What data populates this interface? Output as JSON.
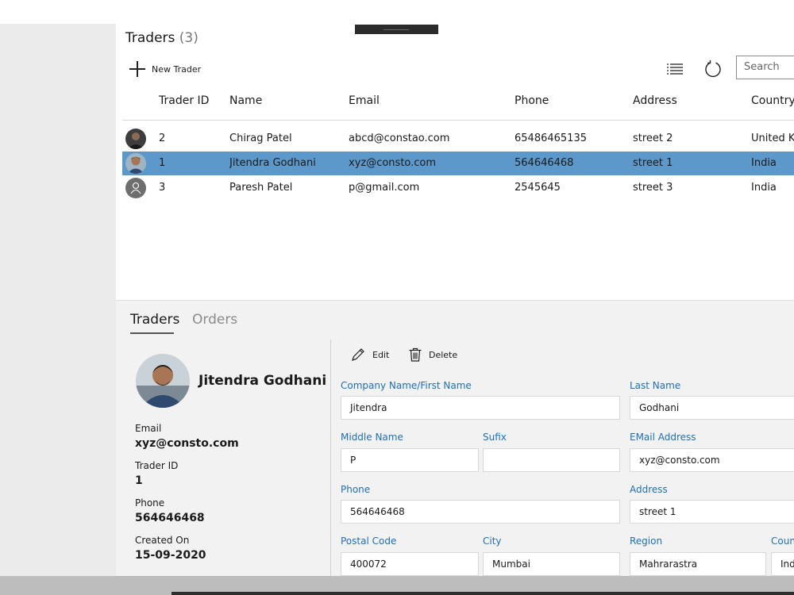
{
  "page": {
    "title": "Traders",
    "count": "(3)"
  },
  "toolbar": {
    "new_trader_label": "New Trader",
    "list_icon": "list-icon",
    "refresh_icon": "refresh-icon",
    "search_placeholder": "Search"
  },
  "columns": [
    "Trader ID",
    "Name",
    "Email",
    "Phone",
    "Address",
    "Country"
  ],
  "rows": [
    {
      "avatar": "photo",
      "id": "2",
      "name": "Chirag Patel",
      "email": "abcd@constao.com",
      "phone": "65486465135",
      "address": "street 2",
      "country": "United Kingdom",
      "selected": false
    },
    {
      "avatar": "photo",
      "id": "1",
      "name": "Jitendra Godhani",
      "email": "xyz@consto.com",
      "phone": "564646468",
      "address": "street 1",
      "country": "India",
      "selected": true
    },
    {
      "avatar": "placeholder",
      "id": "3",
      "name": "Paresh Patel",
      "email": "p@gmail.com",
      "phone": "2545645",
      "address": "street 3",
      "country": "India",
      "selected": false
    }
  ],
  "tabs": {
    "traders": "Traders",
    "orders": "Orders",
    "active": "Traders"
  },
  "detail": {
    "name": "Jitendra Godhani",
    "email_label": "Email",
    "email": "xyz@consto.com",
    "trader_id_label": "Trader ID",
    "trader_id": "1",
    "phone_label": "Phone",
    "phone": "564646468",
    "created_label": "Created On",
    "created": "15-09-2020"
  },
  "actions": {
    "edit": "Edit",
    "delete": "Delete"
  },
  "form": {
    "company_label": "Company Name/First Name",
    "company": "Jitendra",
    "last_name_label": "Last Name",
    "last_name": "Godhani",
    "middle_label": "Middle Name",
    "middle": "P",
    "suffix_label": "Sufix",
    "suffix": "",
    "email_label": "EMail Address",
    "email": "xyz@consto.com",
    "phone_label": "Phone",
    "phone": "564646468",
    "address_label": "Address",
    "address": "street 1",
    "postal_label": "Postal Code",
    "postal": "400072",
    "city_label": "City",
    "city": "Mumbai",
    "region_label": "Region",
    "region": "Mahrarastra",
    "country_label": "Country",
    "country": "India"
  },
  "colors": {
    "selection": "#5c98c9",
    "label_blue": "#1f6fb5",
    "side_pane": "#ebebeb",
    "detail_bg": "#f2f2f2"
  }
}
